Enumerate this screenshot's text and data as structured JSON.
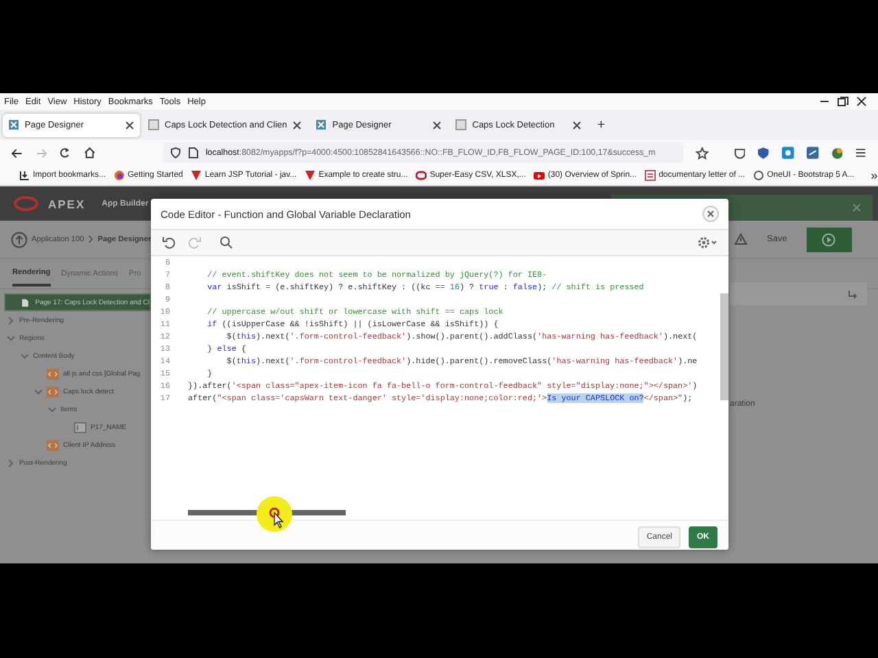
{
  "browser": {
    "menu": [
      "File",
      "Edit",
      "View",
      "History",
      "Bookmarks",
      "Tools",
      "Help"
    ],
    "tabs": [
      {
        "label": "Page Designer",
        "selected": true,
        "kind": "apex"
      },
      {
        "label": "Caps Lock Detection and Clien",
        "selected": false,
        "kind": "page"
      },
      {
        "label": "Page Designer",
        "selected": false,
        "kind": "apex"
      },
      {
        "label": "Caps Lock Detection",
        "selected": false,
        "kind": "page"
      }
    ],
    "new_tab": "+",
    "url_host": "localhost",
    "url_rest": ":8082/myapps/f?p=4000:4500:10852841643566::NO::FB_FLOW_ID,FB_FLOW_PAGE_ID:100,17&success_m",
    "bookmarks": [
      {
        "label": "Import bookmarks...",
        "kind": "import"
      },
      {
        "label": "Getting Started",
        "kind": "browser"
      },
      {
        "label": "Learn JSP Tutorial - jav...",
        "kind": "vee"
      },
      {
        "label": "Example to create stru...",
        "kind": "vee"
      },
      {
        "label": "Super-Easy CSV, XLSX,...",
        "kind": "oracle"
      },
      {
        "label": "(30) Overview of Sprin...",
        "kind": "video"
      },
      {
        "label": "documentary letter of ...",
        "kind": "document"
      },
      {
        "label": "OneUI - Bootstrap 5 A...",
        "kind": "globe"
      }
    ],
    "bookmarks_more": "»"
  },
  "apex": {
    "brand": "APEX",
    "product": "App Builder",
    "breadcrumb": [
      "Application 100",
      "Page Designer"
    ],
    "tabs": [
      {
        "label": "Rendering",
        "selected": true
      },
      {
        "label": "Dynamic Actions",
        "selected": false
      },
      {
        "label": "Pro",
        "selected": false
      }
    ],
    "tree": [
      {
        "label": "Page 17: Caps Lock Detection and Cl",
        "kind": "page",
        "selected": true
      },
      {
        "label": "Pre-Rendering",
        "kind": "group",
        "selected": false,
        "expanded": false
      },
      {
        "label": "Regions",
        "kind": "group",
        "selected": false,
        "expanded": true,
        "children": [
          {
            "label": "Content Body",
            "kind": "group",
            "selected": false,
            "expanded": true,
            "children": [
              {
                "label": "all js and css [Global Pag",
                "kind": "region",
                "selected": false
              },
              {
                "label": "Caps lock detect",
                "kind": "region",
                "selected": false,
                "expanded": true,
                "children": [
                  {
                    "label": "Items",
                    "kind": "group",
                    "selected": false,
                    "expanded": true,
                    "children": [
                      {
                        "label": "P17_NAME",
                        "kind": "item",
                        "selected": false
                      }
                    ]
                  }
                ]
              },
              {
                "label": "Client IP Address",
                "kind": "region",
                "selected": false
              }
            ]
          }
        ]
      },
      {
        "label": "Post-Rendering",
        "kind": "group",
        "selected": false,
        "expanded": false
      }
    ],
    "save": "Save",
    "property_text": "aration"
  },
  "dialog": {
    "title": "Code Editor - Function and Global Variable Declaration",
    "toolbar": [
      {
        "kind": "undo",
        "disabled": false
      },
      {
        "kind": "redo",
        "disabled": true
      },
      {
        "kind": "search",
        "disabled": false
      }
    ],
    "lines": [
      {
        "number": "6"
      },
      {
        "number": "7",
        "segments": [
          {
            "kind": "comment",
            "text": "    // event.shiftKey does not seem to be normalized by jQuery(?) for IE8-"
          }
        ]
      },
      {
        "number": "8",
        "segments": [
          {
            "kind": "keyword",
            "text": "    var"
          },
          {
            "kind": "plain",
            "text": " isShift = (e.shiftKey) ? e.shiftKey : ((kc == "
          },
          {
            "kind": "number",
            "text": "16"
          },
          {
            "kind": "plain",
            "text": ") ? "
          },
          {
            "kind": "keyword",
            "text": "true"
          },
          {
            "kind": "plain",
            "text": " : "
          },
          {
            "kind": "keyword",
            "text": "false"
          },
          {
            "kind": "plain",
            "text": "); "
          },
          {
            "kind": "comment",
            "text": "// shift is pressed"
          }
        ]
      },
      {
        "number": "9"
      },
      {
        "number": "10",
        "segments": [
          {
            "kind": "comment",
            "text": "    // uppercase w/out shift or lowercase with shift == caps lock"
          }
        ]
      },
      {
        "number": "11",
        "segments": [
          {
            "kind": "keyword",
            "text": "    if"
          },
          {
            "kind": "plain",
            "text": " ((isUpperCase && !isShift) || (isLowerCase && isShift)) {"
          }
        ]
      },
      {
        "number": "12",
        "segments": [
          {
            "kind": "plain",
            "text": "        $("
          },
          {
            "kind": "keyword",
            "text": "this"
          },
          {
            "kind": "plain",
            "text": ").next("
          },
          {
            "kind": "string",
            "text": "'.form-control-feedback'"
          },
          {
            "kind": "plain",
            "text": ").show().parent().addClass("
          },
          {
            "kind": "string",
            "text": "'has-warning has-feedback'"
          },
          {
            "kind": "plain",
            "text": ").next("
          }
        ]
      },
      {
        "number": "13",
        "segments": [
          {
            "kind": "plain",
            "text": "    } "
          },
          {
            "kind": "keyword",
            "text": "else"
          },
          {
            "kind": "plain",
            "text": " {"
          }
        ]
      },
      {
        "number": "14",
        "segments": [
          {
            "kind": "plain",
            "text": "        $("
          },
          {
            "kind": "keyword",
            "text": "this"
          },
          {
            "kind": "plain",
            "text": ").next("
          },
          {
            "kind": "string",
            "text": "'.form-control-feedback'"
          },
          {
            "kind": "plain",
            "text": ").hide().parent().removeClass("
          },
          {
            "kind": "string",
            "text": "'has-warning has-feedback'"
          },
          {
            "kind": "plain",
            "text": ").ne"
          }
        ]
      },
      {
        "number": "15",
        "segments": [
          {
            "kind": "plain",
            "text": "    }"
          }
        ]
      },
      {
        "number": "16",
        "segments": [
          {
            "kind": "plain",
            "text": "}).after("
          },
          {
            "kind": "string",
            "text": "'<span class=\"apex-item-icon fa fa-bell-o form-control-feedback\" style=\"display:none;\"></span>'"
          },
          {
            "kind": "plain",
            "text": ")"
          }
        ]
      },
      {
        "number": "17",
        "segments": [
          {
            "kind": "plain",
            "text": "after("
          },
          {
            "kind": "string",
            "text": "\"<span class='capsWarn text-danger' style='display:none;color:red;'>"
          },
          {
            "kind": "selected",
            "text": "Is your CAPSLOCK on?"
          },
          {
            "kind": "string",
            "text": "</span>\""
          },
          {
            "kind": "plain",
            "text": ");"
          }
        ]
      }
    ],
    "buttons": [
      {
        "label": "Cancel",
        "kind": "secondary"
      },
      {
        "label": "OK",
        "kind": "primary"
      }
    ]
  }
}
